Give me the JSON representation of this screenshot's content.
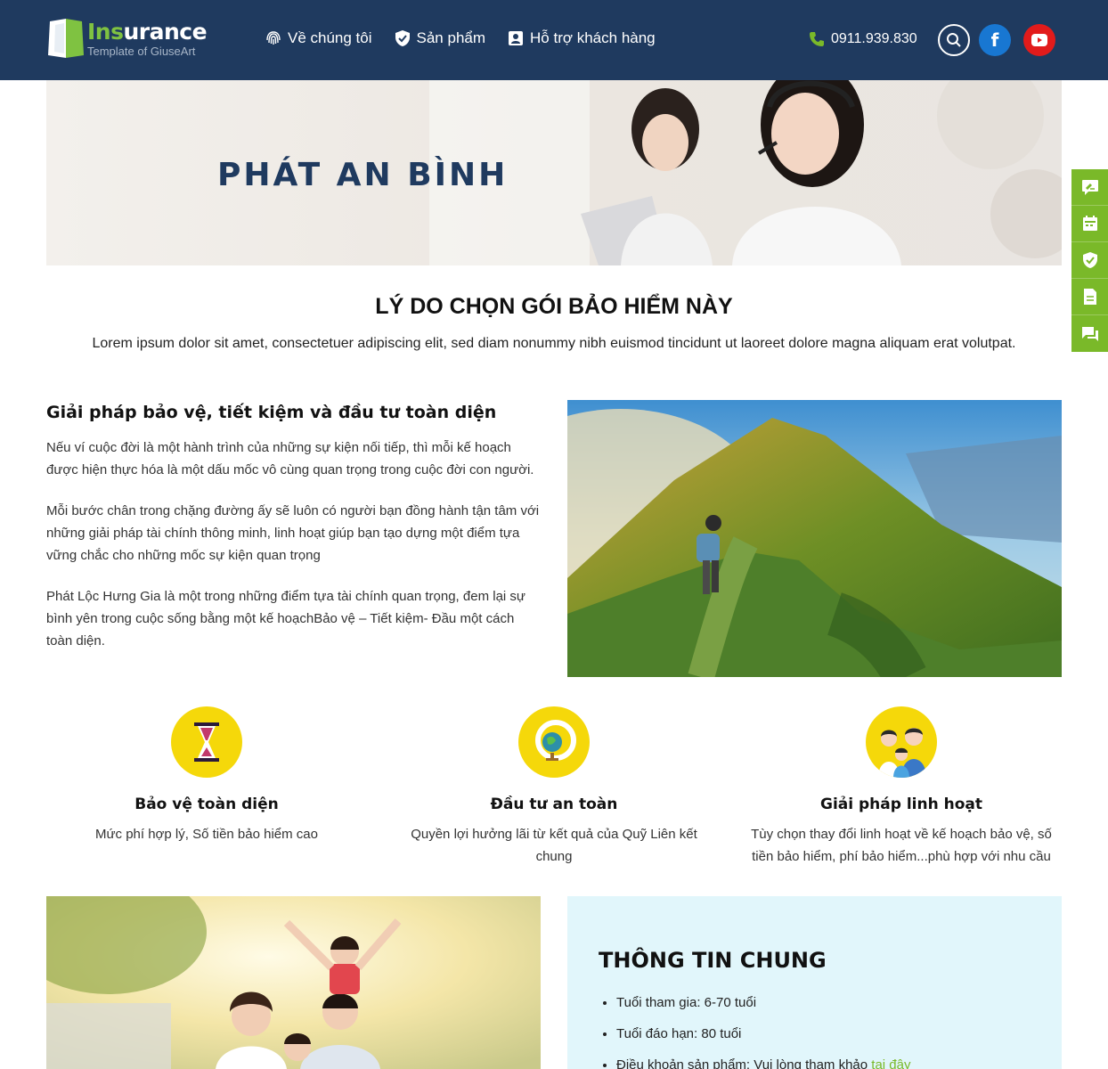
{
  "header": {
    "logo_title_green": "Ins",
    "logo_title_white": "urance",
    "logo_subtitle": "Template of GiuseArt",
    "nav": [
      {
        "label": "Về chúng tôi",
        "icon": "fingerprint-icon"
      },
      {
        "label": "Sản phẩm",
        "icon": "shield-check-icon"
      },
      {
        "label": "Hỗ trợ khách hàng",
        "icon": "contact-card-icon"
      }
    ],
    "phone": "0911.939.830",
    "facebook_label": "f"
  },
  "banner": {
    "title": "PHÁT AN BÌNH"
  },
  "side_widget": [
    "quote-icon",
    "calendar-icon",
    "shield-check-icon",
    "document-icon",
    "chat-icon"
  ],
  "reasons": {
    "title": "LÝ DO CHỌN GÓI BẢO HIỂM NÀY",
    "description": "Lorem ipsum dolor sit amet, consectetuer adipiscing elit, sed diam nonummy nibh euismod tincidunt ut laoreet dolore magna aliquam erat volutpat."
  },
  "solution": {
    "heading": "Giải pháp bảo vệ, tiết kiệm và đầu tư toàn diện",
    "paragraphs": [
      "Nếu ví cuộc đời là một hành trình của những sự kiện nối tiếp, thì mỗi kế hoạch được hiện thực hóa là một dấu mốc vô cùng quan trọng trong cuộc đời con người.",
      "Mỗi bước chân trong chặng đường ấy sẽ luôn có người bạn đồng hành tận tâm với những giải pháp tài chính thông minh, linh hoạt giúp bạn tạo dựng một điểm tựa vững chắc cho những mốc sự kiện quan trọng",
      "Phát Lộc Hưng Gia là một trong những điểm tựa tài chính quan trọng, đem lại sự bình yên trong cuộc sống bằng một kế hoạchBảo vệ – Tiết kiệm- Đầu  một cách toàn diện."
    ]
  },
  "features": [
    {
      "title": "Bảo vệ toàn diện",
      "text": "Mức phí hợp lý, Số tiền bảo hiểm cao",
      "icon": "hourglass-icon"
    },
    {
      "title": "Đầu tư an toàn",
      "text": "Quyền lợi hưởng lãi từ kết quả của Quỹ Liên kết chung",
      "icon": "globe-icon"
    },
    {
      "title": "Giải pháp linh hoạt",
      "text": "Tùy chọn thay đổi linh hoạt về kế hoạch bảo vệ, số tiền bảo hiểm, phí bảo hiểm...phù hợp với nhu cầu",
      "icon": "family-icon"
    }
  ],
  "general_info": {
    "title": "THÔNG TIN CHUNG",
    "items": [
      "Tuổi tham gia: 6-70 tuổi",
      "Tuổi đáo hạn: 80 tuổi"
    ],
    "terms_prefix": "Điều khoản sản phẩm: Vui lòng tham khảo ",
    "terms_link": "tại đây"
  }
}
